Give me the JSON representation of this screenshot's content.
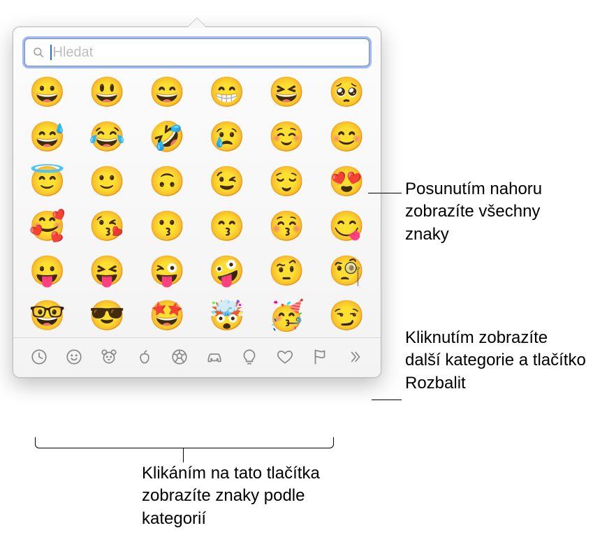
{
  "search": {
    "placeholder": "Hledat",
    "value": ""
  },
  "emoji_rows": [
    [
      "😀",
      "😃",
      "😄",
      "😁",
      "😆",
      "🥺"
    ],
    [
      "😅",
      "😂",
      "🤣",
      "😢",
      "☺️",
      "😊"
    ],
    [
      "😇",
      "🙂",
      "🙃",
      "😉",
      "😌",
      "😍"
    ],
    [
      "🥰",
      "😘",
      "😗",
      "😙",
      "😚",
      "😋"
    ],
    [
      "😛",
      "😝",
      "😜",
      "🤪",
      "🤨",
      "🧐"
    ],
    [
      "🤓",
      "😎",
      "🤩",
      "🤯",
      "🥳",
      "😏"
    ]
  ],
  "categories": [
    {
      "name": "recent",
      "icon": "clock-icon"
    },
    {
      "name": "smileys",
      "icon": "smiley-icon"
    },
    {
      "name": "animals",
      "icon": "animal-icon"
    },
    {
      "name": "food",
      "icon": "apple-icon"
    },
    {
      "name": "activity",
      "icon": "soccer-icon"
    },
    {
      "name": "travel",
      "icon": "car-icon"
    },
    {
      "name": "objects",
      "icon": "bulb-icon"
    },
    {
      "name": "symbols",
      "icon": "heart-icon"
    },
    {
      "name": "flags",
      "icon": "flag-icon"
    },
    {
      "name": "more",
      "icon": "more-icon"
    }
  ],
  "callouts": {
    "scroll": "Posunutím nahoru zobrazíte všechny znaky",
    "more": "Kliknutím zobrazíte další kategorie a tlačítko Rozbalit",
    "cats": "Klikáním na tato tlačítka zobrazíte znaky podle kategorií"
  }
}
